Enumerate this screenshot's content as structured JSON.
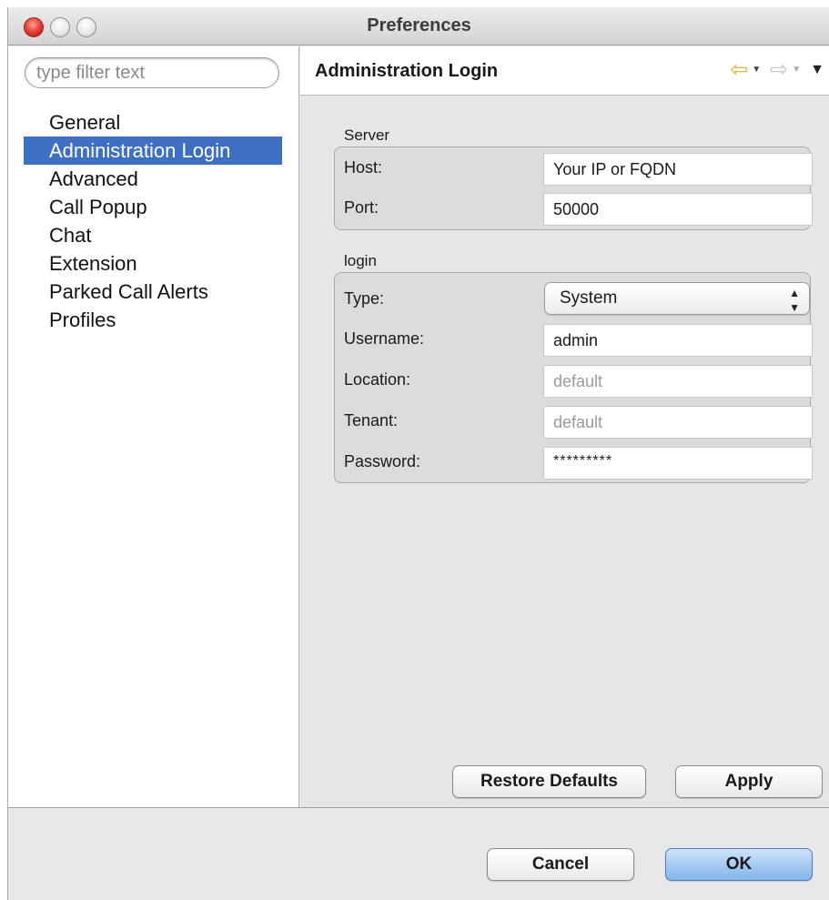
{
  "window": {
    "title": "Preferences"
  },
  "sidebar": {
    "filter_placeholder": "type filter text",
    "items": [
      {
        "label": "General"
      },
      {
        "label": "Administration Login",
        "selected": true
      },
      {
        "label": "Advanced"
      },
      {
        "label": "Call Popup"
      },
      {
        "label": "Chat"
      },
      {
        "label": "Extension"
      },
      {
        "label": "Parked Call Alerts"
      },
      {
        "label": "Profiles"
      }
    ]
  },
  "page": {
    "title": "Administration Login",
    "server": {
      "group_label": "Server",
      "host_label": "Host:",
      "host_value": "Your IP or FQDN",
      "port_label": "Port:",
      "port_value": "50000"
    },
    "login": {
      "group_label": "login",
      "type_label": "Type:",
      "type_value": "System",
      "username_label": "Username:",
      "username_value": "admin",
      "location_label": "Location:",
      "location_placeholder": "default",
      "tenant_label": "Tenant:",
      "tenant_placeholder": "default",
      "password_label": "Password:",
      "password_value": "*********"
    },
    "restore_defaults_label": "Restore Defaults",
    "apply_label": "Apply"
  },
  "footer": {
    "cancel_label": "Cancel",
    "ok_label": "OK"
  },
  "colors": {
    "selection": "#3d70c4",
    "back_arrow": "#e0b730",
    "default_button": "#7fb5ea"
  }
}
